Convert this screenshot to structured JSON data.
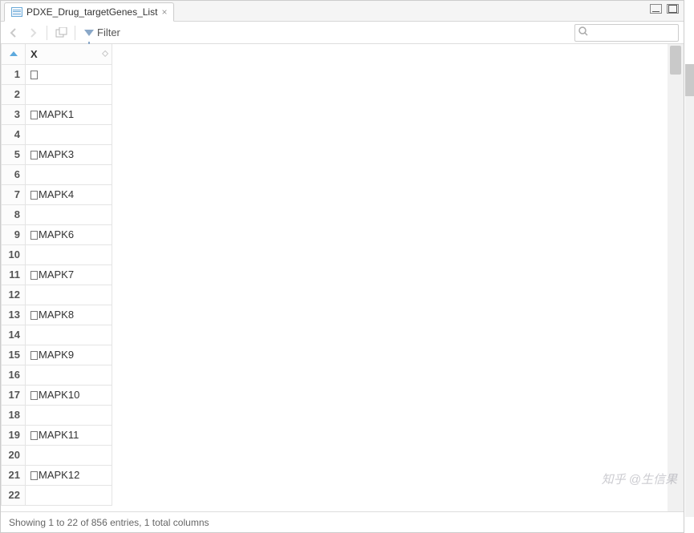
{
  "tab": {
    "title": "PDXE_Drug_targetGenes_List"
  },
  "toolbar": {
    "filter_label": "Filter",
    "search_placeholder": ""
  },
  "table": {
    "caret_dir": "asc",
    "columns": [
      {
        "name": "X"
      }
    ],
    "rows": [
      {
        "n": 1,
        "X": "□"
      },
      {
        "n": 2,
        "X": ""
      },
      {
        "n": 3,
        "X": "□MAPK1"
      },
      {
        "n": 4,
        "X": ""
      },
      {
        "n": 5,
        "X": "□MAPK3"
      },
      {
        "n": 6,
        "X": ""
      },
      {
        "n": 7,
        "X": "□MAPK4"
      },
      {
        "n": 8,
        "X": ""
      },
      {
        "n": 9,
        "X": "□MAPK6"
      },
      {
        "n": 10,
        "X": ""
      },
      {
        "n": 11,
        "X": "□MAPK7"
      },
      {
        "n": 12,
        "X": ""
      },
      {
        "n": 13,
        "X": "□MAPK8"
      },
      {
        "n": 14,
        "X": ""
      },
      {
        "n": 15,
        "X": "□MAPK9"
      },
      {
        "n": 16,
        "X": ""
      },
      {
        "n": 17,
        "X": "□MAPK10"
      },
      {
        "n": 18,
        "X": ""
      },
      {
        "n": 19,
        "X": "□MAPK11"
      },
      {
        "n": 20,
        "X": ""
      },
      {
        "n": 21,
        "X": "□MAPK12"
      },
      {
        "n": 22,
        "X": ""
      }
    ]
  },
  "status": {
    "text": "Showing 1 to 22 of 856 entries, 1 total columns"
  },
  "watermark": "知乎  @生信果"
}
